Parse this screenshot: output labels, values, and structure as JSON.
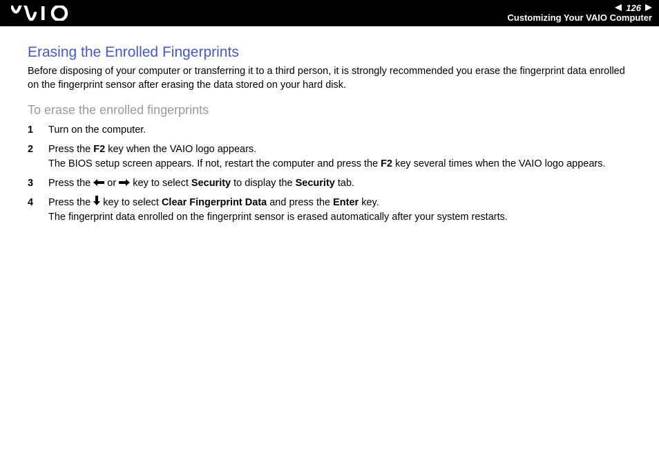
{
  "header": {
    "page_number": "126",
    "section": "Customizing Your VAIO Computer"
  },
  "content": {
    "title": "Erasing the Enrolled Fingerprints",
    "intro": "Before disposing of your computer or transferring it to a third person, it is strongly recommended you erase the fingerprint data enrolled on the fingerprint sensor after erasing the data stored on your hard disk.",
    "subhead": "To erase the enrolled fingerprints",
    "steps": [
      {
        "num": "1",
        "body_plain": "Turn on the computer."
      },
      {
        "num": "2",
        "part_a": "Press the ",
        "bold_a": "F2",
        "part_b": " key when the VAIO logo appears.",
        "line2_a": "The BIOS setup screen appears. If not, restart the computer and press the ",
        "line2_bold": "F2",
        "line2_b": " key several times when the VAIO logo appears."
      },
      {
        "num": "3",
        "part_a": "Press the ",
        "mid": " or ",
        "part_b": " key to select ",
        "bold_b": "Security",
        "part_c": " to display the ",
        "bold_c": "Security",
        "part_d": " tab."
      },
      {
        "num": "4",
        "part_a": "Press the ",
        "part_b": " key to select ",
        "bold_b": "Clear Fingerprint Data",
        "part_c": " and press the ",
        "bold_c": "Enter",
        "part_d": " key.",
        "line2": "The fingerprint data enrolled on the fingerprint sensor is erased automatically after your system restarts."
      }
    ]
  }
}
